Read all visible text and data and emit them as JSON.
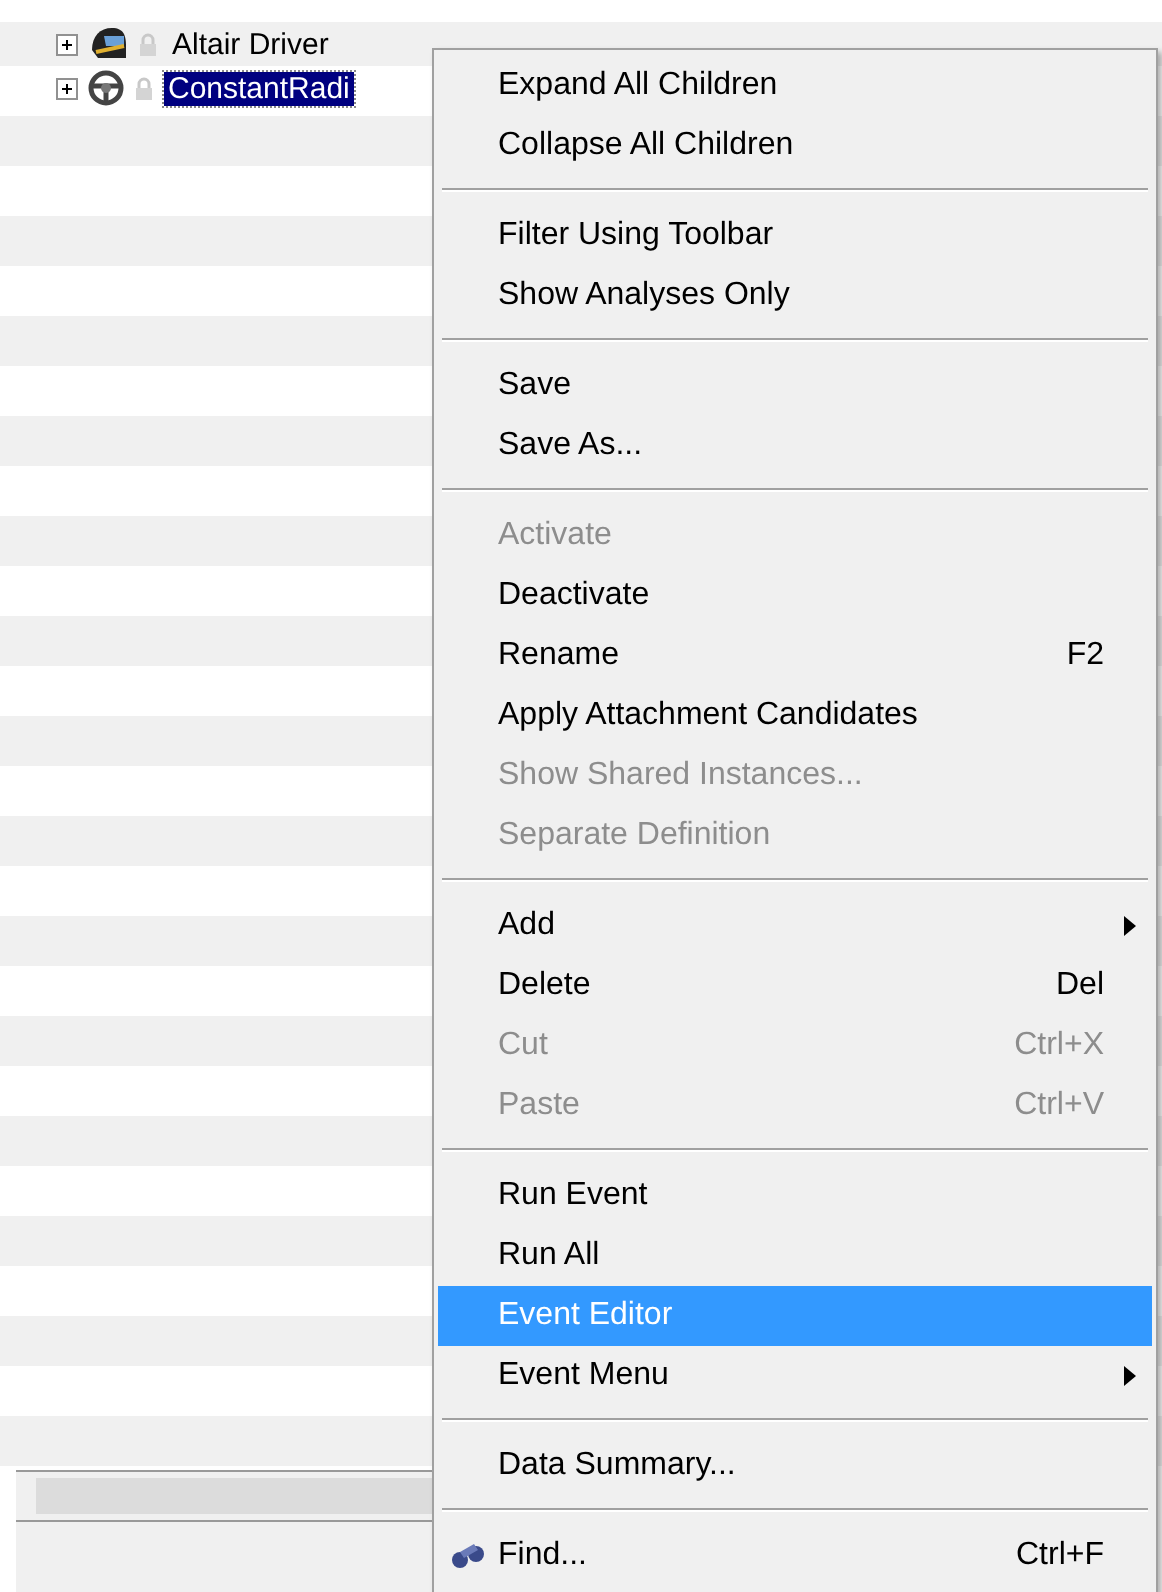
{
  "tree": {
    "rows": [
      {
        "name": "Altair Driver",
        "expanded": false,
        "selected": false
      },
      {
        "name": "ConstantRadi",
        "expanded": false,
        "selected": true
      }
    ]
  },
  "context_menu": {
    "sections": [
      [
        {
          "label": "Expand All Children",
          "disabled": false,
          "selected": false
        },
        {
          "label": "Collapse All Children",
          "disabled": false,
          "selected": false
        }
      ],
      [
        {
          "label": "Filter Using Toolbar",
          "disabled": false,
          "selected": false
        },
        {
          "label": "Show Analyses Only",
          "disabled": false,
          "selected": false
        }
      ],
      [
        {
          "label": "Save",
          "disabled": false,
          "selected": false
        },
        {
          "label": "Save As...",
          "disabled": false,
          "selected": false
        }
      ],
      [
        {
          "label": "Activate",
          "disabled": true,
          "selected": false
        },
        {
          "label": "Deactivate",
          "disabled": false,
          "selected": false
        },
        {
          "label": "Rename",
          "shortcut": "F2",
          "disabled": false,
          "selected": false
        },
        {
          "label": "Apply Attachment Candidates",
          "disabled": false,
          "selected": false
        },
        {
          "label": "Show Shared Instances...",
          "disabled": true,
          "selected": false
        },
        {
          "label": "Separate Definition",
          "disabled": true,
          "selected": false
        }
      ],
      [
        {
          "label": "Add",
          "submenu": true,
          "disabled": false,
          "selected": false
        },
        {
          "label": "Delete",
          "shortcut": "Del",
          "disabled": false,
          "selected": false
        },
        {
          "label": "Cut",
          "shortcut": "Ctrl+X",
          "disabled": true,
          "selected": false
        },
        {
          "label": "Paste",
          "shortcut": "Ctrl+V",
          "disabled": true,
          "selected": false
        }
      ],
      [
        {
          "label": "Run Event",
          "disabled": false,
          "selected": false
        },
        {
          "label": "Run All",
          "disabled": false,
          "selected": false
        },
        {
          "label": "Event Editor",
          "disabled": false,
          "selected": true
        },
        {
          "label": "Event Menu",
          "submenu": true,
          "disabled": false,
          "selected": false
        }
      ],
      [
        {
          "label": "Data Summary...",
          "disabled": false,
          "selected": false
        }
      ],
      [
        {
          "label": "Find...",
          "shortcut": "Ctrl+F",
          "disabled": false,
          "selected": false
        }
      ]
    ]
  }
}
